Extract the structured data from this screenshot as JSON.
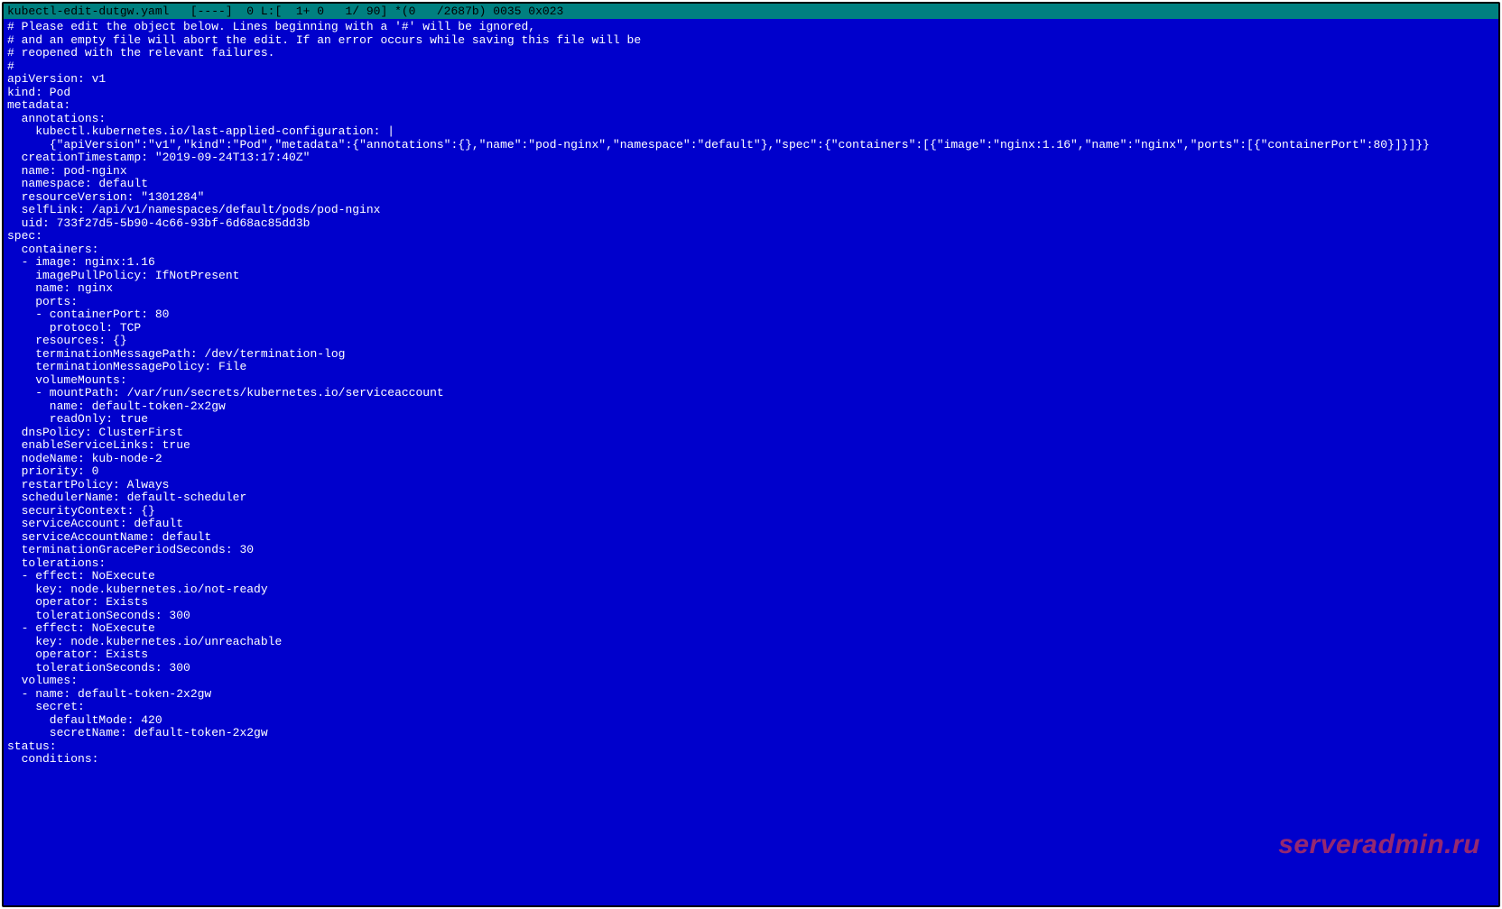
{
  "titlebar": {
    "text": "kubectl-edit-dutgw.yaml   [----]  0 L:[  1+ 0   1/ 90] *(0   /2687b) 0035 0x023"
  },
  "watermark": "serveradmin.ru",
  "editor_lines": [
    "# Please edit the object below. Lines beginning with a '#' will be ignored,",
    "# and an empty file will abort the edit. If an error occurs while saving this file will be",
    "# reopened with the relevant failures.",
    "#",
    "apiVersion: v1",
    "kind: Pod",
    "metadata:",
    "  annotations:",
    "    kubectl.kubernetes.io/last-applied-configuration: |",
    "      {\"apiVersion\":\"v1\",\"kind\":\"Pod\",\"metadata\":{\"annotations\":{},\"name\":\"pod-nginx\",\"namespace\":\"default\"},\"spec\":{\"containers\":[{\"image\":\"nginx:1.16\",\"name\":\"nginx\",\"ports\":[{\"containerPort\":80}]}]}}",
    "  creationTimestamp: \"2019-09-24T13:17:40Z\"",
    "  name: pod-nginx",
    "  namespace: default",
    "  resourceVersion: \"1301284\"",
    "  selfLink: /api/v1/namespaces/default/pods/pod-nginx",
    "  uid: 733f27d5-5b90-4c66-93bf-6d68ac85dd3b",
    "spec:",
    "  containers:",
    "  - image: nginx:1.16",
    "    imagePullPolicy: IfNotPresent",
    "    name: nginx",
    "    ports:",
    "    - containerPort: 80",
    "      protocol: TCP",
    "    resources: {}",
    "    terminationMessagePath: /dev/termination-log",
    "    terminationMessagePolicy: File",
    "    volumeMounts:",
    "    - mountPath: /var/run/secrets/kubernetes.io/serviceaccount",
    "      name: default-token-2x2gw",
    "      readOnly: true",
    "  dnsPolicy: ClusterFirst",
    "  enableServiceLinks: true",
    "  nodeName: kub-node-2",
    "  priority: 0",
    "  restartPolicy: Always",
    "  schedulerName: default-scheduler",
    "  securityContext: {}",
    "  serviceAccount: default",
    "  serviceAccountName: default",
    "  terminationGracePeriodSeconds: 30",
    "  tolerations:",
    "  - effect: NoExecute",
    "    key: node.kubernetes.io/not-ready",
    "    operator: Exists",
    "    tolerationSeconds: 300",
    "  - effect: NoExecute",
    "    key: node.kubernetes.io/unreachable",
    "    operator: Exists",
    "    tolerationSeconds: 300",
    "  volumes:",
    "  - name: default-token-2x2gw",
    "    secret:",
    "      defaultMode: 420",
    "      secretName: default-token-2x2gw",
    "status:",
    "  conditions:"
  ]
}
